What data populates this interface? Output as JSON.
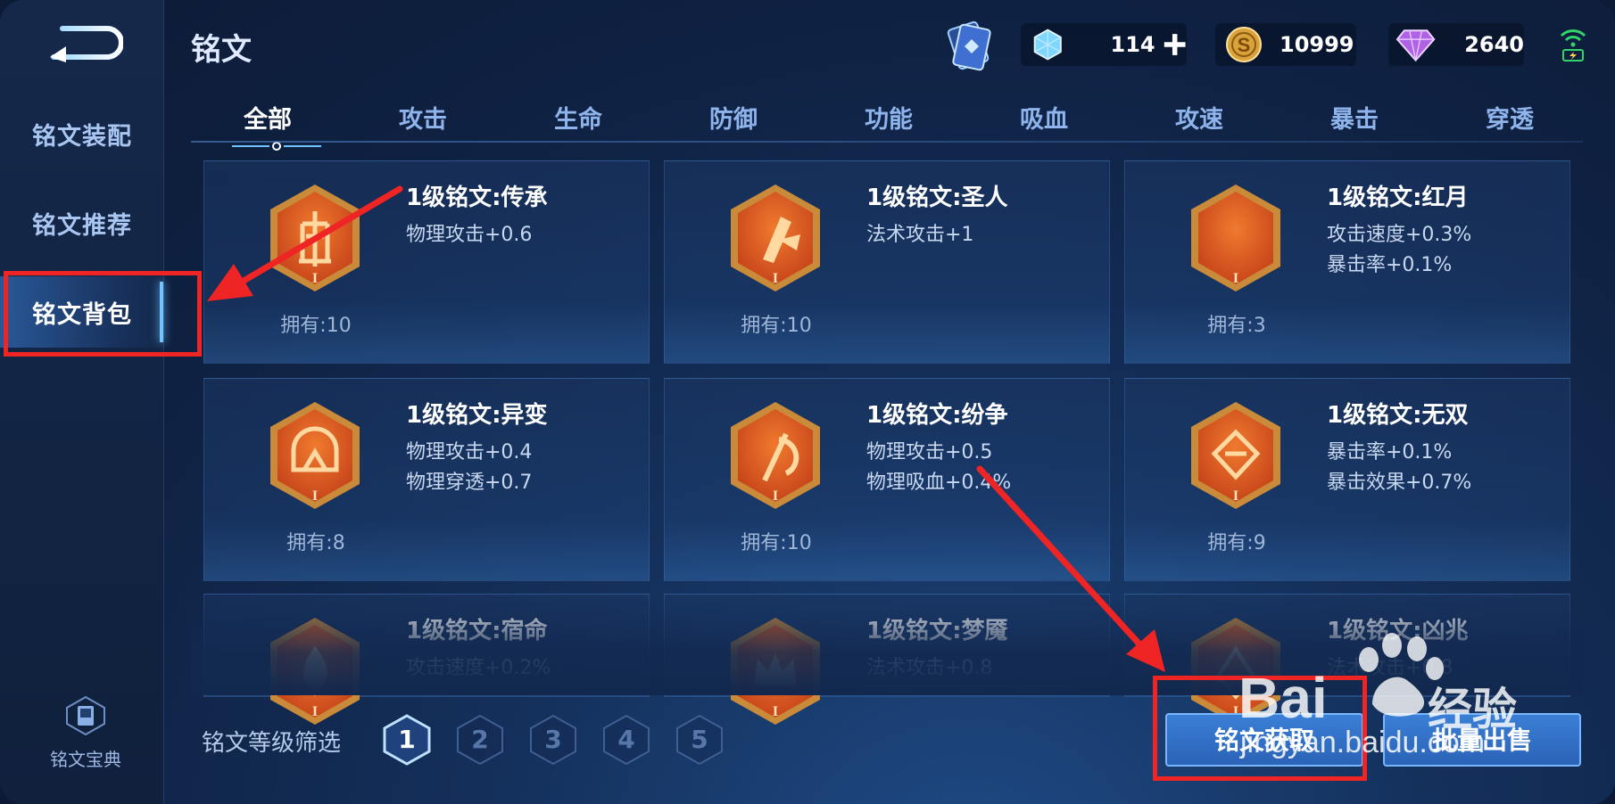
{
  "header": {
    "title": "铭文",
    "currencies": [
      {
        "icon": "ice-crystal-icon",
        "value": "114"
      },
      {
        "icon": "gold-coin-icon",
        "value": "10999"
      },
      {
        "icon": "diamond-icon",
        "value": "2640"
      }
    ]
  },
  "sidebar": {
    "items": [
      {
        "label": "铭文装配"
      },
      {
        "label": "铭文推荐"
      },
      {
        "label": "铭文背包"
      }
    ],
    "codex_label": "铭文宝典"
  },
  "tabs": [
    "全部",
    "攻击",
    "生命",
    "防御",
    "功能",
    "吸血",
    "攻速",
    "暴击",
    "穿透"
  ],
  "cards": [
    {
      "name": "1级铭文:传承",
      "stats": [
        "物理攻击+0.6"
      ],
      "owned": "拥有:10",
      "glyph": "tower"
    },
    {
      "name": "1级铭文:圣人",
      "stats": [
        "法术攻击+1"
      ],
      "owned": "拥有:10",
      "glyph": "crystal"
    },
    {
      "name": "1级铭文:红月",
      "stats": [
        "攻击速度+0.3%",
        "暴击率+0.1%"
      ],
      "owned": "拥有:3",
      "glyph": "moon"
    },
    {
      "name": "1级铭文:异变",
      "stats": [
        "物理攻击+0.4",
        "物理穿透+0.7"
      ],
      "owned": "拥有:8",
      "glyph": "helm"
    },
    {
      "name": "1级铭文:纷争",
      "stats": [
        "物理攻击+0.5",
        "物理吸血+0.4%"
      ],
      "owned": "拥有:10",
      "glyph": "axe"
    },
    {
      "name": "1级铭文:无双",
      "stats": [
        "暴击率+0.1%",
        "暴击效果+0.7%"
      ],
      "owned": "拥有:9",
      "glyph": "gem"
    },
    {
      "name": "1级铭文:宿命",
      "stats": [
        "攻击速度+0.2%"
      ],
      "owned": "",
      "glyph": "flame"
    },
    {
      "name": "1级铭文:梦魇",
      "stats": [
        "法术攻击+0.8"
      ],
      "owned": "",
      "glyph": "crown"
    },
    {
      "name": "1级铭文:凶兆",
      "stats": [
        "法术攻击+0.8"
      ],
      "owned": "",
      "glyph": "shard"
    }
  ],
  "filter": {
    "label": "铭文等级筛选",
    "levels": [
      "1",
      "2",
      "3",
      "4",
      "5"
    ],
    "active": "1"
  },
  "buttons": {
    "acquire": "铭文获取",
    "bulk_sell": "批量出售"
  },
  "watermark": {
    "brand": "Bai",
    "cn": "经验",
    "url": "jingyan.baidu.com"
  },
  "colors": {
    "annotation": "#ef2424",
    "accent": "#6fc3ff",
    "emblem": "#c8461b"
  }
}
